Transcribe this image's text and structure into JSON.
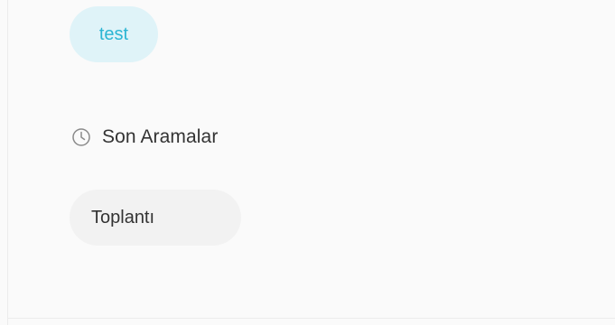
{
  "active_search": {
    "chip_label": "test"
  },
  "recent_searches": {
    "header_icon": "clock-icon",
    "title": "Son Aramalar",
    "items": [
      {
        "label": "Toplantı"
      }
    ]
  },
  "colors": {
    "accent_text": "#2bb5d3",
    "accent_bg": "#dff3f8",
    "chip_bg": "#f2f2f2",
    "panel_bg": "#fafafa"
  }
}
